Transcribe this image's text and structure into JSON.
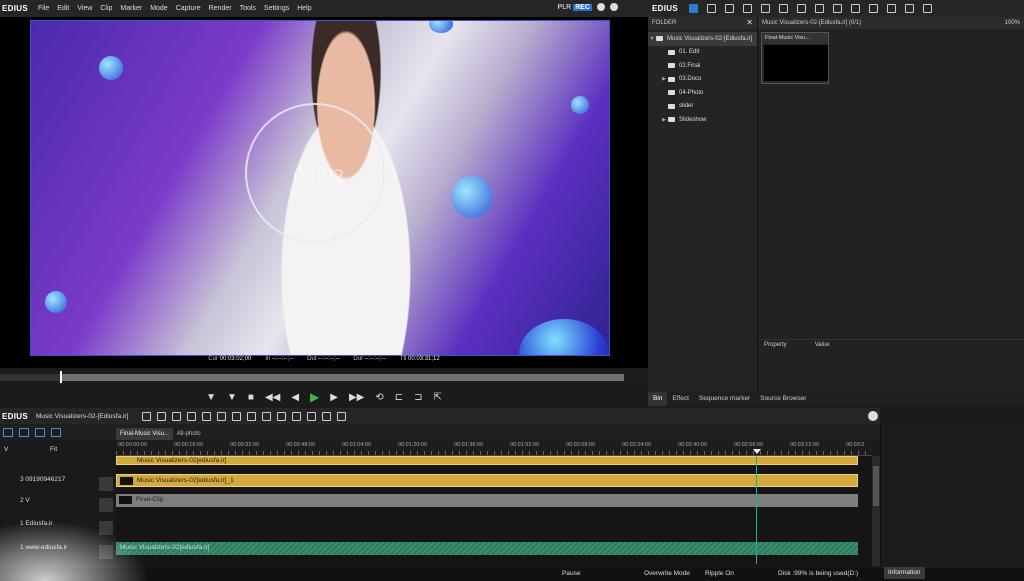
{
  "app": {
    "logo": "EDIUS"
  },
  "menu": [
    "File",
    "Edit",
    "View",
    "Clip",
    "Marker",
    "Mode",
    "Capture",
    "Render",
    "Tools",
    "Settings",
    "Help"
  ],
  "mode": {
    "plr": "PLR",
    "rec": "REC"
  },
  "preview": {
    "overlay_time": "03:02",
    "timecodes": [
      {
        "label": "Cur",
        "value": "00:03:02;00"
      },
      {
        "label": "In",
        "value": "--:--:--;--"
      },
      {
        "label": "Out",
        "value": "--:--:--;--"
      },
      {
        "label": "Dur",
        "value": "--:--:--;--"
      },
      {
        "label": "Ttl",
        "value": "00:03:31;12"
      }
    ],
    "accent": "#3a55c6"
  },
  "folder_pane": {
    "title": "FOLDER",
    "root": "Music Visualizers-02-[Ediusfa.ir]",
    "items": [
      {
        "label": "01. Edit",
        "expandable": false
      },
      {
        "label": "02.Final",
        "expandable": false
      },
      {
        "label": "03.Doco",
        "expandable": true
      },
      {
        "label": "04-Photo",
        "expandable": false
      },
      {
        "label": "slider",
        "expandable": false
      },
      {
        "label": "Slideshow",
        "expandable": true
      }
    ]
  },
  "bin_pane": {
    "title": "Music Visualizers-02-[Ediusfa.ir] (0/1)",
    "zoom": "100%",
    "clip_label": "Final-Music Visu...",
    "property_header": "Property",
    "value_header": "Value"
  },
  "bottom_tabs": [
    "Bin",
    "Effect",
    "Sequence marker",
    "Source Browser"
  ],
  "timeline": {
    "logo": "EDIUS",
    "sequence_name": "Music Visualizers-02-[Ediusfa.ir]",
    "tabs": [
      "Final-Music Visu...",
      "All-photo"
    ],
    "fit_label": "Fit",
    "ruler": [
      "00:00:00;00",
      "00:00:16:00",
      "00:00:32:00",
      "00:00:48:00",
      "00:01:04:00",
      "00:01:20:00",
      "00:01:36:00",
      "00:01:52:00",
      "00:02:08:00",
      "00:02:24:00",
      "00:02:40:00",
      "00:02:56:00",
      "00:03:12:00",
      "00:03:2"
    ],
    "tracks": [
      {
        "name": "3 09190946217",
        "clip": "Music Visualizers-02[ediusfa.ir]_1",
        "type": "gold"
      },
      {
        "name": "2 V",
        "clip": "Final-Clip",
        "type": "gray"
      },
      {
        "name": "1 Ediusfa.ir",
        "clip": "",
        "type": "empty"
      },
      {
        "name": "1 www.ediusfa.ir",
        "clip": "Music Visualizers-02[ediusfa.ir]",
        "type": "audio"
      }
    ],
    "top_clip": "Music Visualizers-02[ediusfa.ir]",
    "v_label": "V"
  },
  "status": {
    "state": "Pause",
    "mode": "Overwrite Mode",
    "ripple": "Ripple On",
    "disk": "Disk :99% is being used(D:)",
    "info_tab": "Information"
  }
}
